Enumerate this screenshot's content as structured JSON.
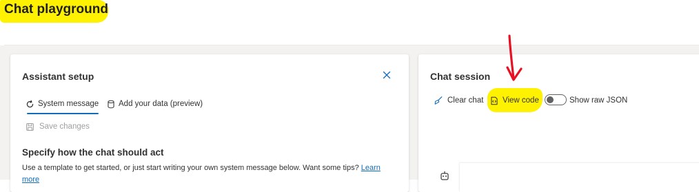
{
  "page": {
    "title": "Chat playground"
  },
  "assistant_setup": {
    "heading": "Assistant setup",
    "tabs": [
      {
        "label": "System message",
        "icon": "refresh-icon",
        "active": true
      },
      {
        "label": "Add your data (preview)",
        "icon": "database-icon",
        "active": false
      }
    ],
    "save_changes_label": "Save changes",
    "section_title": "Specify how the chat should act",
    "section_description": "Use a template to get started, or just start writing your own system message below. Want some tips?",
    "learn_more_link": "Learn more"
  },
  "chat_session": {
    "heading": "Chat session",
    "clear_chat_label": "Clear chat",
    "view_code_label": "View code",
    "show_raw_json_label": "Show raw JSON",
    "show_raw_json_on": false
  },
  "annotations": {
    "highlight_color": "#fff200",
    "arrow_color": "#e81123"
  },
  "colors": {
    "accent": "#0f6cbd",
    "workspace_bg": "#f3f2f1",
    "disabled_text": "#a19f9d"
  }
}
